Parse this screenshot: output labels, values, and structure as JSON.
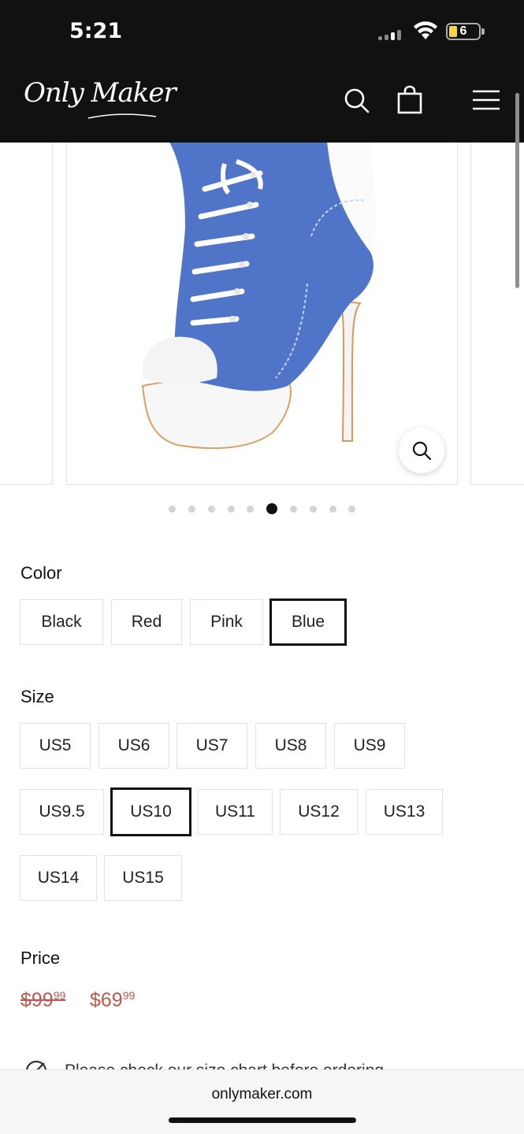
{
  "status_bar": {
    "time": "5:21",
    "battery": "6",
    "battery_color": "#f3d64b"
  },
  "header": {
    "logo_text": "Only Maker",
    "icons": [
      "search-icon",
      "shopping-bag-icon",
      "menu-icon"
    ]
  },
  "gallery": {
    "slide_count": 10,
    "active_index": 5,
    "product_color": "#4f74c8"
  },
  "color": {
    "label": "Color",
    "options": [
      "Black",
      "Red",
      "Pink",
      "Blue"
    ],
    "selected": "Blue"
  },
  "size": {
    "label": "Size",
    "options": [
      "US5",
      "US6",
      "US7",
      "US8",
      "US9",
      "US9.5",
      "US10",
      "US11",
      "US12",
      "US13",
      "US14",
      "US15"
    ],
    "selected": "US10"
  },
  "price": {
    "label": "Price",
    "original": "$99",
    "original_cents": "99",
    "sale": "$69",
    "sale_cents": "99",
    "color": "#c0564c"
  },
  "note": {
    "text": "Please check our size chart before ordering",
    "icon": "ruler-pencil-icon"
  },
  "browser": {
    "url": "onlymaker.com"
  }
}
